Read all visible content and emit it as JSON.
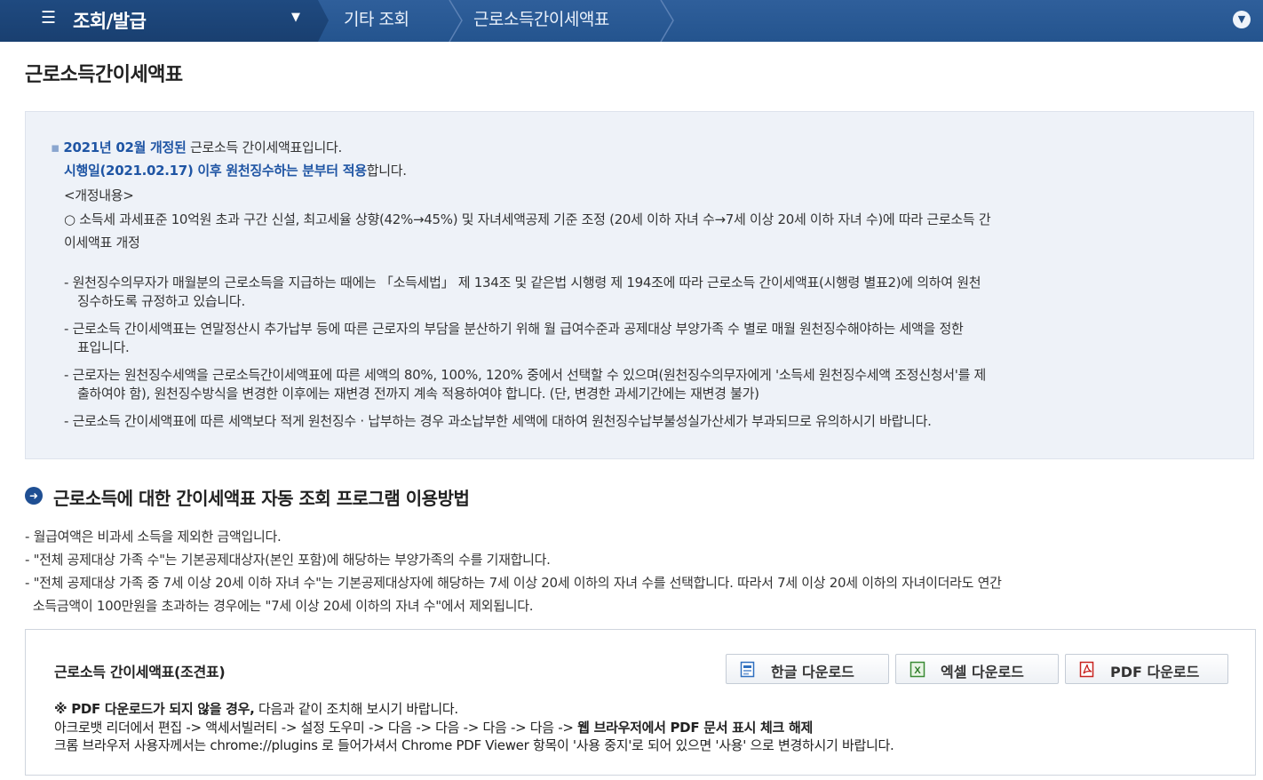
{
  "topbar": {
    "menu_icon": "☰",
    "menu_title": "조회/발급",
    "breadcrumbs": [
      "기타 조회",
      "근로소득간이세액표"
    ]
  },
  "page": {
    "title": "근로소득간이세액표"
  },
  "notice": {
    "line1_bold": "2021년 02월  개정된",
    "line1_rest": " 근로소득 간이세액표입니다.",
    "line2_bold": "시행일(2021.02.17) 이후 원천징수하는 분부터 적용",
    "line2_rest": "합니다.",
    "revision_label": "<개정내용>",
    "revision_text_1": "○ 소득세 과세표준 10억원 초과 구간 신설, 최고세율 상향(42%→45%) 및 자녀세액공제 기준 조정 (20세 이하 자녀 수→7세 이상 20세 이하 자녀 수)에 따라 근로소득 간",
    "revision_text_2": "이세액표 개정",
    "items": [
      [
        "- 원천징수의무자가 매월분의 근로소득을 지급하는 때에는 「소득세법」 제 134조 및 같은법 시행령 제 194조에 따라 근로소득 간이세액표(시행령 별표2)에 의하여 원천",
        "징수하도록 규정하고 있습니다."
      ],
      [
        "- 근로소득 간이세액표는 연말정산시 추가납부 등에 따른 근로자의 부담을 분산하기 위해 월 급여수준과 공제대상 부양가족 수 별로 매월 원천징수해야하는 세액을 정한",
        "표입니다."
      ],
      [
        "- 근로자는 원천징수세액을 근로소득간이세액표에 따른 세액의 80%, 100%, 120% 중에서 선택할 수 있으며(원천징수의무자에게 '소득세 원천징수세액 조정신청서'를 제",
        "출하여야 함), 원천징수방식을 변경한 이후에는 재변경 전까지 계속 적용하여야 합니다. (단, 변경한 과세기간에는 재변경 불가)"
      ],
      [
        "- 근로소득 간이세액표에 따른 세액보다 적게 원천징수 · 납부하는 경우 과소납부한 세액에 대하여 원천징수납부불성실가산세가 부과되므로 유의하시기 바랍니다."
      ]
    ]
  },
  "usage": {
    "title": "근로소득에 대한 간이세액표 자동 조회 프로그램 이용방법",
    "lines": [
      "- 월급여액은  비과세 소득을 제외한 금액입니다.",
      "- \"전체 공제대상 가족 수\"는 기본공제대상자(본인 포함)에 해당하는 부양가족의 수를 기재합니다.",
      "- \"전체 공제대상 가족 중 7세 이상 20세 이하 자녀 수\"는 기본공제대상자에 해당하는 7세 이상 20세 이하의 자녀 수를 선택합니다. 따라서 7세 이상 20세 이하의 자녀이더라도 연간",
      "  소득금액이 100만원을 초과하는 경우에는 \"7세 이상 20세 이하의 자녀 수\"에서 제외됩니다."
    ]
  },
  "download": {
    "title": "근로소득 간이세액표(조견표)",
    "buttons": {
      "hwp": "한글 다운로드",
      "excel": "엑셀 다운로드",
      "pdf": "PDF 다운로드"
    },
    "note1_bold": "※ PDF 다운로드가 되지 않을 경우,",
    "note1_rest": " 다음과 같이 조치해 보시기 바랍니다.",
    "note2_plain": "아크로뱃 리더에서 편집 -> 액세서빌러티 -> 설정 도우미 -> 다음 -> 다음 -> 다음 -> 다음 -> ",
    "note2_bold": "웹 브라우저에서 PDF 문서 표시 체크 해제",
    "note3": "크롬 브라우저 사용자께서는 chrome://plugins 로 들어가셔서 Chrome PDF Viewer 항목이 '사용 중지'로 되어 있으면 '사용' 으로 변경하시기 바랍니다."
  },
  "colors": {
    "topbar": "#2a5894",
    "menu_block": "#1c4478",
    "accent_blue": "#1f55a4",
    "notice_bg": "#eef2f8"
  },
  "icons": {
    "menu": "hamburger-icon",
    "caret": "caret-down-icon",
    "toggle": "chevron-down-circle-icon",
    "section": "arrow-right-circle-icon",
    "hwp": "hwp-file-icon",
    "excel": "excel-file-icon",
    "pdf": "pdf-file-icon"
  }
}
